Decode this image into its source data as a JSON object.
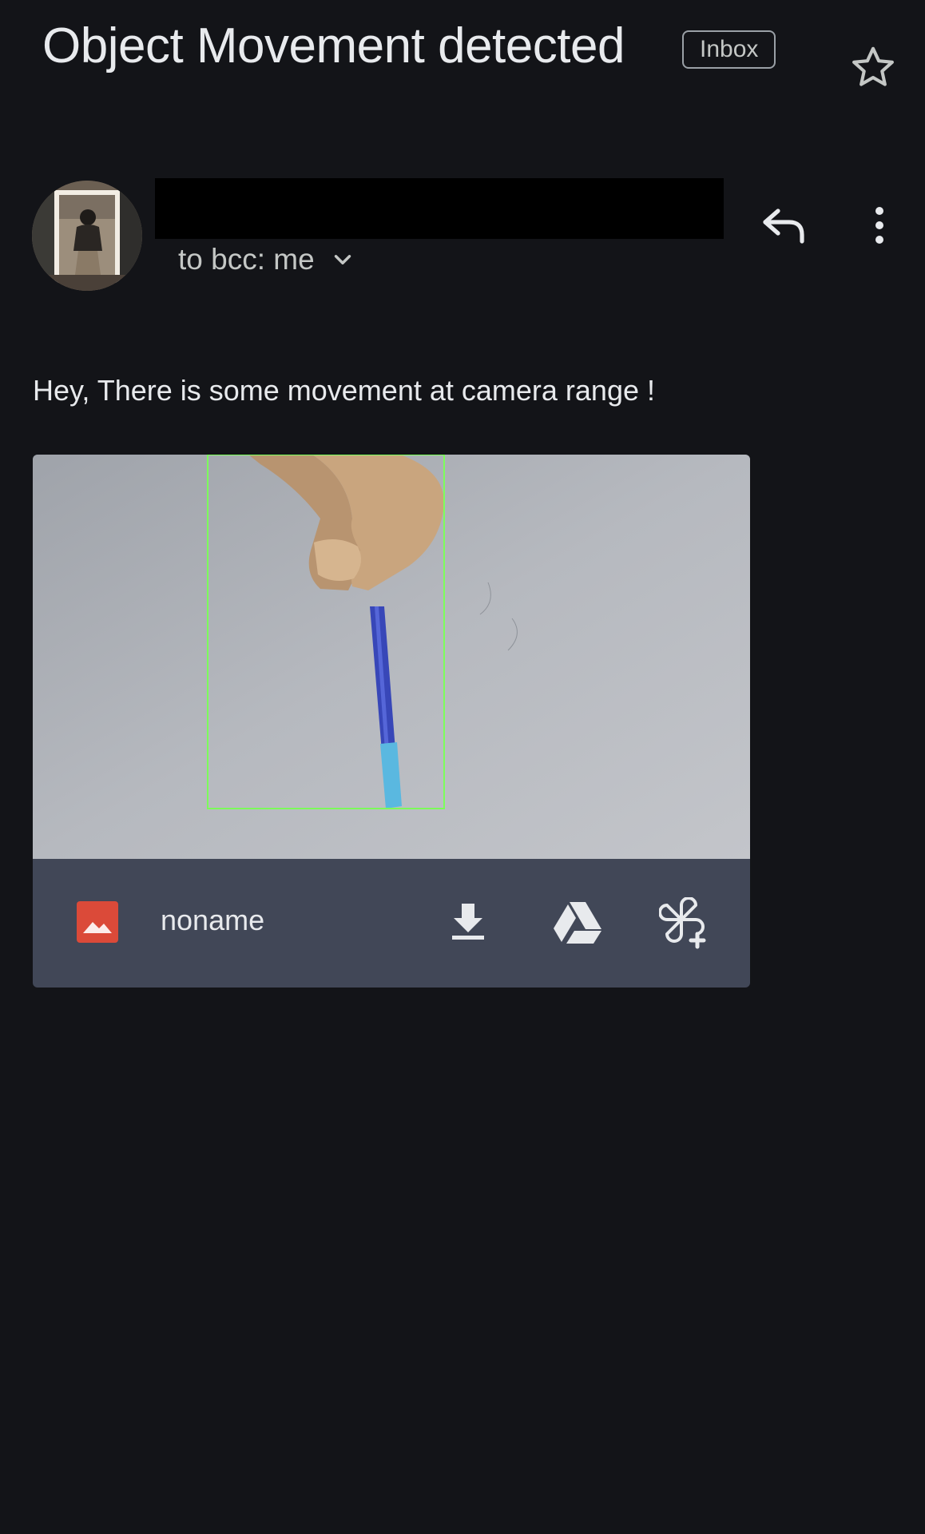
{
  "header": {
    "subject": "Object Movement detected",
    "label": "Inbox",
    "star_icon": "star-outline-icon"
  },
  "sender": {
    "recipients_text": "to bcc: me",
    "expand_icon": "chevron-down-icon",
    "reply_icon": "reply-icon",
    "more_icon": "more-vertical-icon"
  },
  "message": {
    "body": "Hey, There is some movement at camera range !"
  },
  "attachment": {
    "filename": "noname",
    "type_icon": "image-file-icon",
    "download_icon": "download-icon",
    "drive_icon": "google-drive-icon",
    "photos_icon": "google-photos-add-icon",
    "file_icon_color": "#db4a39"
  },
  "colors": {
    "background": "#131418",
    "attachment_bar": "#414757",
    "text_primary": "#e8eaed",
    "text_secondary": "#c4c7c5",
    "detection_box": "#7cff5a"
  }
}
